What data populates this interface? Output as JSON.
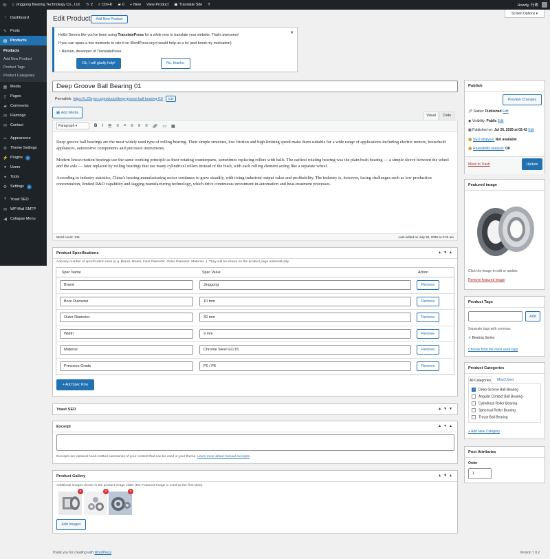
{
  "adminbar": {
    "site_name": "Jinggong Bearing Technology Co., Ltd.",
    "updates_count": "2",
    "shortcut": "Ctrl+K",
    "comments_count": "0",
    "new_label": "New",
    "view_product": "View Product",
    "translate_site": "Translate Site",
    "howdy": "Howdy, 行政"
  },
  "menu": {
    "dashboard": "Dashboard",
    "posts": "Posts",
    "products": "Products",
    "products_sub": [
      "Products",
      "Add New Product",
      "Product Tags",
      "Product Categories"
    ],
    "media": "Media",
    "pages": "Pages",
    "comments": "Comments",
    "flamingo": "Flamingo",
    "contact": "Contact",
    "appearance": "Appearance",
    "theme_settings": "Theme Settings",
    "plugins": "Plugins",
    "plugins_badge": "2",
    "users": "Users",
    "tools": "Tools",
    "settings": "Settings",
    "settings_badge": "2",
    "yoast": "Yoast SEO",
    "wpmail": "WP Mail SMTP",
    "collapse": "Collapse Menu"
  },
  "screen_options": "Screen Options ▾",
  "page": {
    "title": "Edit Product",
    "add_new": "Add New Product"
  },
  "notice": {
    "line1_pre": "Hello! Seems like you've been using ",
    "line1_bold": "TranslatePress",
    "line1_post": " for a while now to translate your website. That's awesome!",
    "line2": "If you can spare a few moments to rate it on WordPress.org it would help us a lot (and boost my motivation).",
    "line3": "~ Razvan, developer of TranslatePress",
    "btn_yes": "Ok, I will gladly help!",
    "btn_no": "No, thanks.",
    "close": "✕"
  },
  "post": {
    "title": "Deep Groove Ball Bearing 01",
    "permalink_label": "Permalink:",
    "permalink_pre": "https://c.23zyw.cn/products/",
    "permalink_slug": "deep-groove-ball-bearing-01",
    "permalink_post": "/",
    "edit": "Edit"
  },
  "editor": {
    "add_media": "Add Media",
    "tab_visual": "Visual",
    "tab_code": "Code",
    "format": "Paragraph",
    "p1": "Deep groove ball bearings are the most widely used type of rolling bearing. Their simple structure, low friction and high limiting speed make them suitable for a wide range of applications including electric motors, household appliances, automotive components and precision instruments.",
    "p2": "Modern linear-motion bearings use the same working principle as their rotating counterparts, sometimes replacing rollers with balls. The earliest rotating bearing was the plain bush bearing — a simple sleeve between the wheel and the axle — later replaced by rolling bearings that use many cylindrical rollers instead of the bush, with each rolling element acting like a separate wheel.",
    "p3": "According to industry statistics, China's bearing manufacturing sector continues to grow steadily, with rising industrial output value and profitability. The industry is, however, facing challenges such as low production concentration, limited R&D capability and lagging manufacturing technology, which drive continuous investment in automation and heat-treatment processes.",
    "word_count": "Word count: 145",
    "last_edited": "Last edited on July 26, 2026 at 2:42 am"
  },
  "specs": {
    "title": "Product Specifications",
    "desc": "Add any number of specification rows (e.g. Brand, Model, Inner Diameter, Outer Diameter, Material...). They will be shown on the product page automatically.",
    "col_name": "Spec Name",
    "col_value": "Spec Value",
    "col_action": "Action",
    "rows": [
      {
        "name": "Brand",
        "value": "Jinggong"
      },
      {
        "name": "Bore Diameter",
        "value": "10 mm"
      },
      {
        "name": "Outer Diameter",
        "value": "30 mm"
      },
      {
        "name": "Width",
        "value": "9 mm"
      },
      {
        "name": "Material",
        "value": "Chrome Steel GCr15"
      },
      {
        "name": "Precision Grade",
        "value": "P0 / P6"
      }
    ],
    "remove": "Remove",
    "add_row": "+ Add Spec Row"
  },
  "yoast_box": "Yoast SEO",
  "excerpt": {
    "title": "Excerpt",
    "help_pre": "Excerpts are optional hand-crafted summaries of your content that can be used in your theme. ",
    "help_link": "Learn more about manual excerpts",
    "help_post": "."
  },
  "gallery": {
    "title": "Product Gallery",
    "desc": "Additional images shown in the product image slider (the Featured Image is used as the first slide).",
    "add_images": "Add Images"
  },
  "publish": {
    "title": "Publish",
    "preview": "Preview Changes",
    "status_label": "Status:",
    "status_value": "Published",
    "visibility_label": "Visibility:",
    "visibility_value": "Public",
    "published_label": "Published on:",
    "published_value": "Jul 26, 2026 at 02:42",
    "seo_label": "SEO analysis:",
    "seo_value": "Not available",
    "read_label": "Readability analysis:",
    "read_value": "OK",
    "edit": "Edit",
    "trash": "Move to Trash",
    "update": "Update"
  },
  "featured": {
    "title": "Featured image",
    "hint": "Click the image to edit or update",
    "remove": "Remove featured image"
  },
  "tags": {
    "title": "Product Tags",
    "add": "Add",
    "sep_hint": "Separate tags with commas",
    "tag": "Bearing Series",
    "choose": "Choose from the most used tags"
  },
  "cats": {
    "title": "Product Categories",
    "tab_all": "All Categories",
    "tab_most": "Most Used",
    "items": [
      "Deep Groove Ball Bearing",
      "Angular Contact Ball Bearing",
      "Cylindrical Roller Bearing",
      "Spherical Roller Bearing",
      "Thrust Ball Bearing"
    ],
    "add_new": "+ Add New Category"
  },
  "attrs": {
    "title": "Post Attributes",
    "order_label": "Order",
    "order_value": "1"
  },
  "footer": {
    "thanks_pre": "Thank you for creating with ",
    "thanks_link": "WordPress",
    "thanks_post": ".",
    "version": "Version 7.0.2"
  },
  "colors": {
    "primary": "#2271b1",
    "adminbar": "#1d2327",
    "danger": "#b32d2e"
  }
}
